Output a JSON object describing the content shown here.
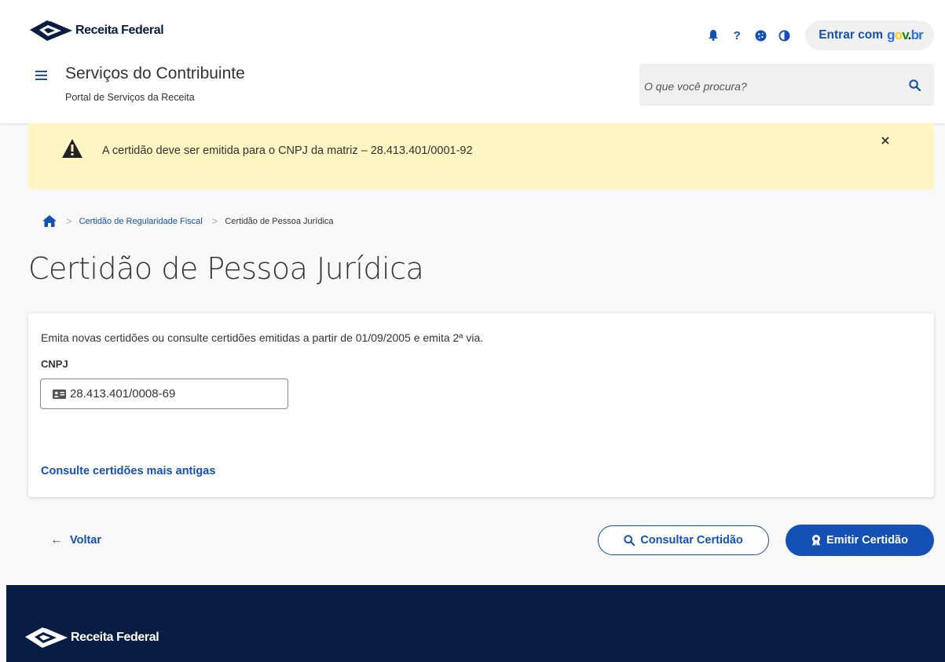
{
  "header": {
    "logo_text": "Receita Federal",
    "icons": [
      "bell-icon",
      "help-icon",
      "cookie-icon",
      "contrast-icon"
    ],
    "login_label": "Entrar com",
    "govbr_letters": [
      "g",
      "o",
      "v",
      ".",
      "br"
    ],
    "site_title": "Serviços do Contribuinte",
    "site_subtitle": "Portal de Serviços da Receita",
    "search_placeholder": "O que você procura?"
  },
  "alert": {
    "text": "A certidão deve ser emitida para o CNPJ da matriz – 28.413.401/0001-92",
    "close_label": "×",
    "color": "#fff5c2"
  },
  "breadcrumb": {
    "items": [
      "Certidão de Regularidade Fiscal",
      "Certidão de Pessoa Jurídica"
    ]
  },
  "page": {
    "title": "Certidão de Pessoa Jurídica"
  },
  "form": {
    "description": "Emita novas certidões ou consulte certidões emitidas a partir de 01/09/2005 e emita 2ª via.",
    "cnpj_label": "CNPJ",
    "cnpj_value": "28.413.401/0008-69",
    "old_certificates_link": "Consulte certidões mais antigas"
  },
  "actions": {
    "back_label": "Voltar",
    "consult_label": "Consultar Certidão",
    "issue_label": "Emitir Certidão"
  },
  "footer": {
    "logo_text": "Receita Federal"
  },
  "colors": {
    "primary": "#1351b4",
    "footer_bg": "#071d41",
    "page_bg": "#f8f8f8"
  }
}
